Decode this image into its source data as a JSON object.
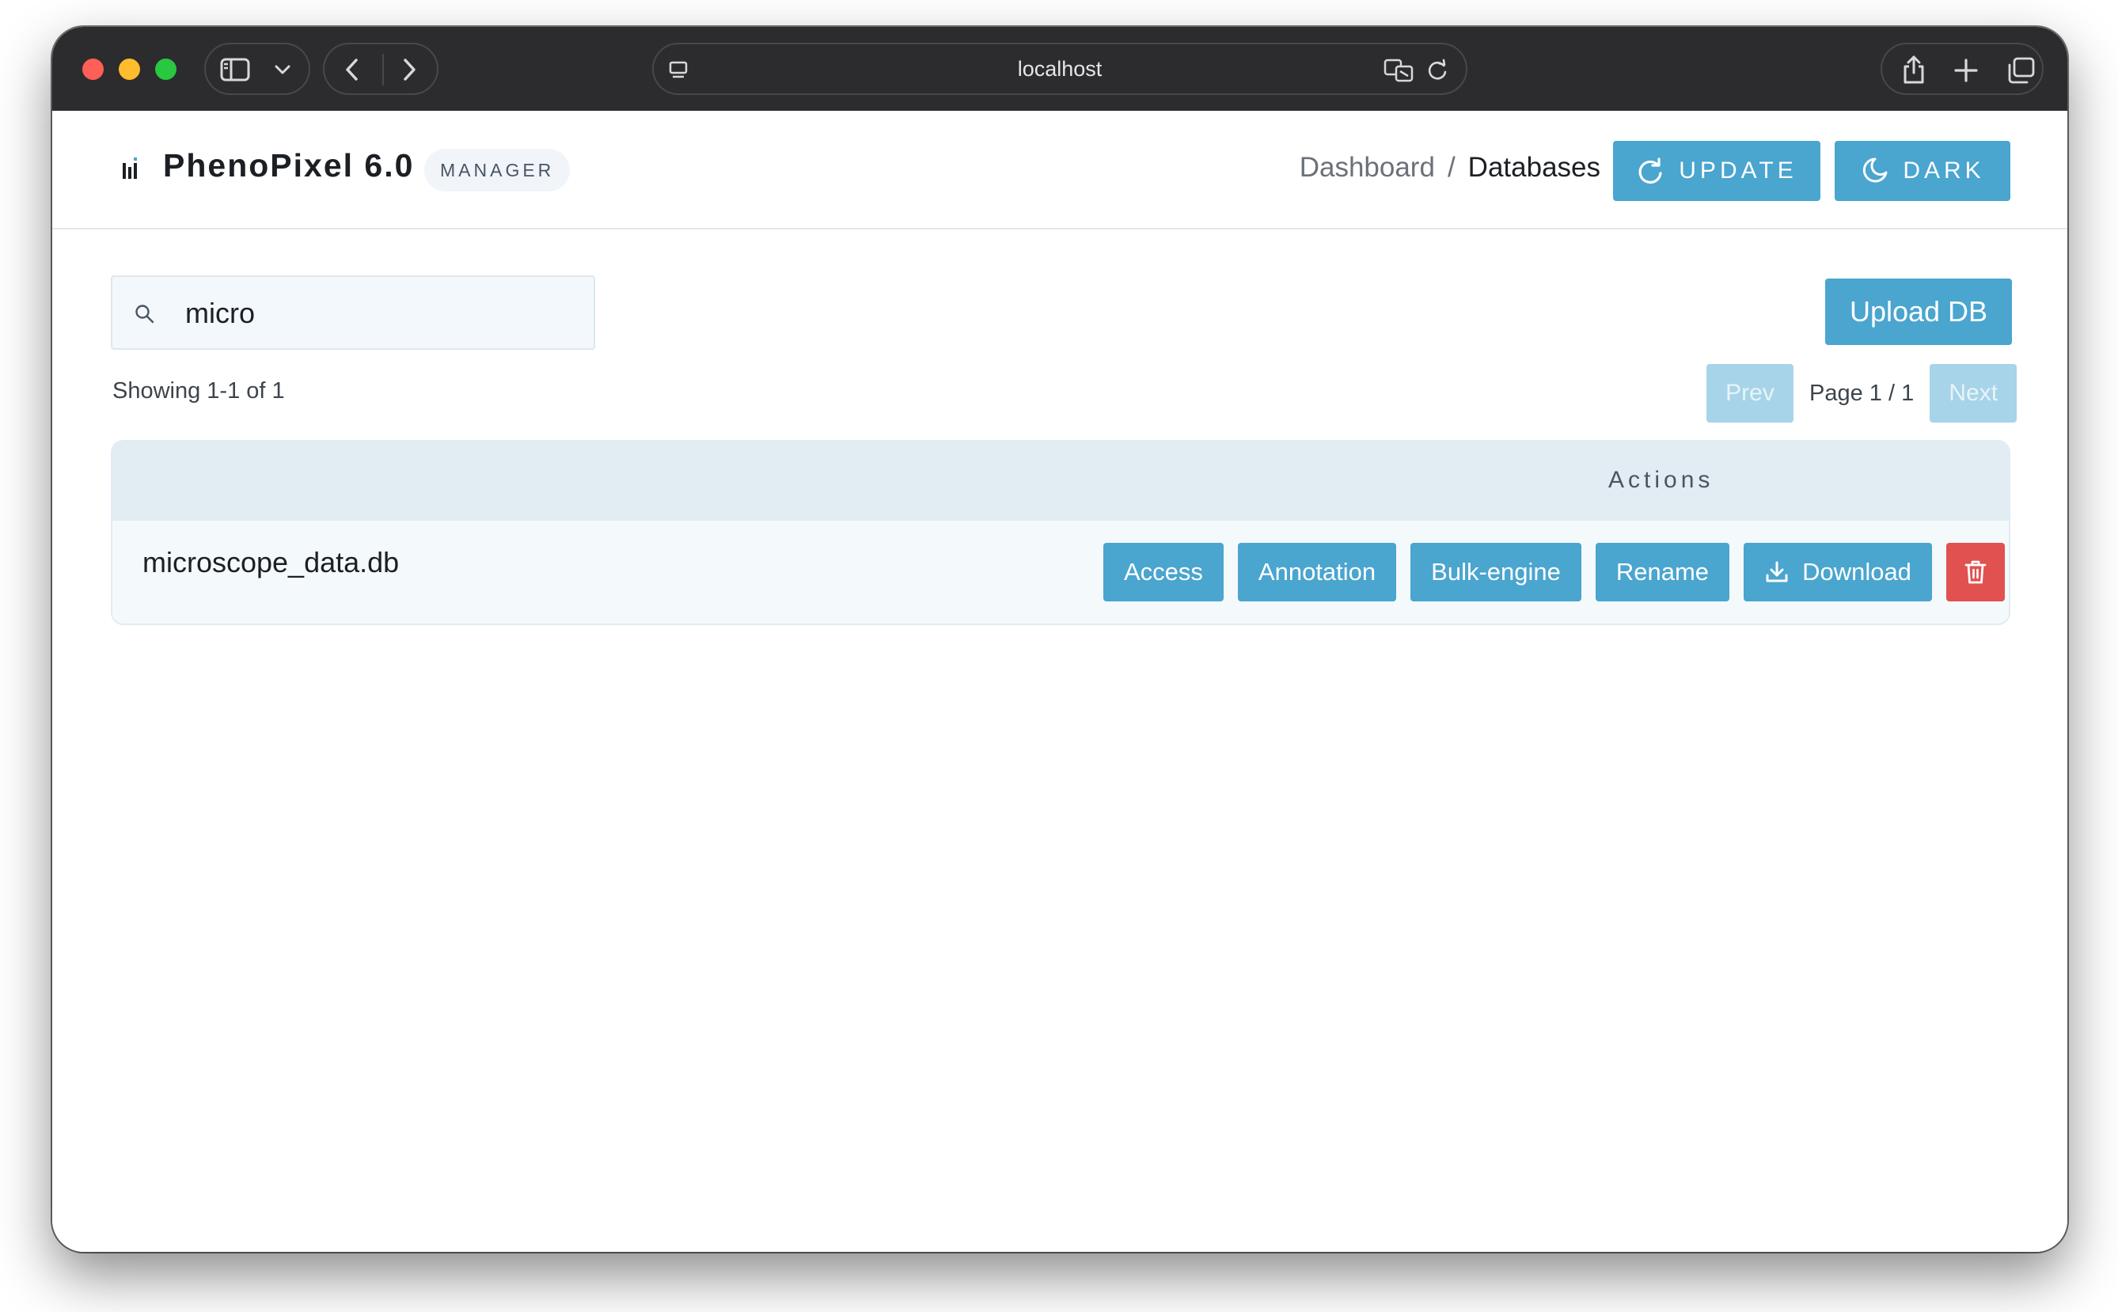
{
  "browser": {
    "url": "localhost"
  },
  "app": {
    "title": "PhenoPixel 6.0",
    "badge": "MANAGER",
    "breadcrumb": {
      "parent": "Dashboard",
      "separator": "/",
      "current": "Databases"
    },
    "buttons": {
      "update": "UPDATE",
      "dark": "DARK"
    }
  },
  "search": {
    "value": "micro",
    "placeholder": ""
  },
  "upload_label": "Upload DB",
  "results": {
    "showing": "Showing 1-1 of 1",
    "prev_label": "Prev",
    "page_label": "Page 1 / 1",
    "next_label": "Next"
  },
  "table": {
    "headers": [
      "",
      "Actions"
    ],
    "rows": [
      {
        "name": "microscope_data.db",
        "actions": {
          "access": "Access",
          "annotation": "Annotation",
          "bulk_engine": "Bulk-engine",
          "rename": "Rename",
          "download": "Download"
        }
      }
    ]
  },
  "colors": {
    "accent": "#4aa5cf",
    "danger": "#e0514f",
    "disabled": "#a7d4e8"
  },
  "icons": {
    "update": "refresh-icon",
    "dark": "moon-icon",
    "search": "search-icon",
    "download": "download-icon",
    "delete": "trash-icon"
  }
}
